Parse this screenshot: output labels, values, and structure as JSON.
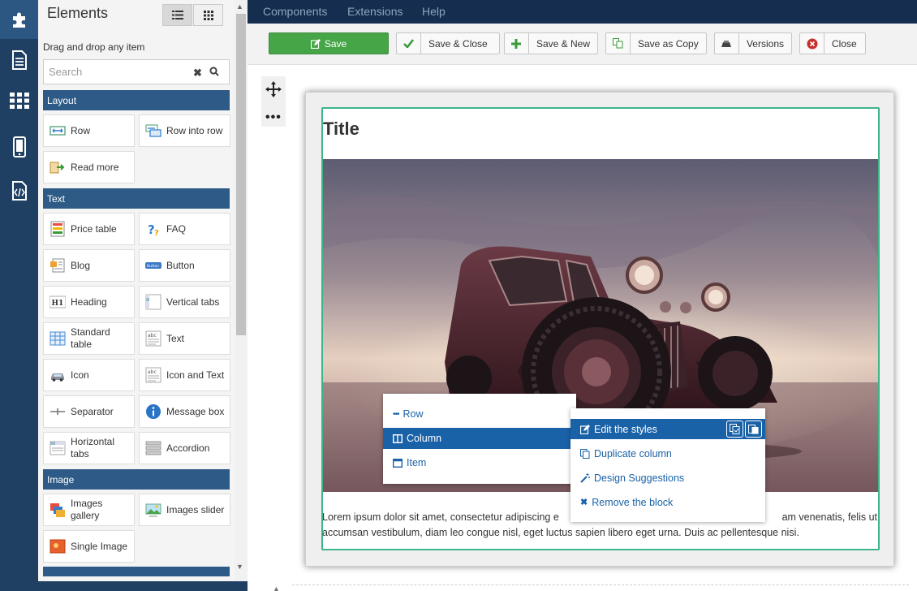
{
  "app": {
    "nav": [
      "Components",
      "Extensions",
      "Help"
    ]
  },
  "rail": {
    "icons": [
      "puzzle-icon",
      "document-icon",
      "grid-icon",
      "mobile-icon",
      "code-file-icon"
    ]
  },
  "panel": {
    "title": "Elements",
    "hint": "Drag and drop any item",
    "search_placeholder": "Search",
    "categories": {
      "layout": "Layout",
      "text": "Text",
      "image": "Image"
    },
    "layout_items": [
      "Row",
      "Row into row",
      "Read more"
    ],
    "text_items": [
      "Price table",
      "FAQ",
      "Blog",
      "Button",
      "Heading",
      "Vertical tabs",
      "Standard table",
      "Text",
      "Icon",
      "Icon and Text",
      "Separator",
      "Message box",
      "Horizontal tabs",
      "Accordion"
    ],
    "image_items": [
      "Images gallery",
      "Images slider",
      "Single Image"
    ]
  },
  "toolbar": {
    "save": "Save",
    "save_close": "Save & Close",
    "save_new": "Save & New",
    "save_copy": "Save as Copy",
    "versions": "Versions",
    "close": "Close"
  },
  "content": {
    "title": "Title",
    "paragraph_left": "Lorem ipsum dolor sit amet, consectetur adipiscing e",
    "paragraph_right": "am venenatis, felis ut",
    "paragraph_line2": "accumsan vestibulum, diam leo congue nisl, eget luctus sapien libero eget urna. Duis ac pellentesque nisi."
  },
  "context_menu": {
    "items": [
      "Row",
      "Column",
      "Item"
    ],
    "selected": "Column"
  },
  "column_menu": {
    "items": [
      "Edit the styles",
      "Duplicate column",
      "Design Suggestions",
      "Remove the block"
    ],
    "selected": "Edit the styles"
  },
  "colors": {
    "rail": "#1f3f63",
    "category": "#2d5a86",
    "accent": "#1a62a8",
    "save_green": "#46a546",
    "block_border": "#3eb489"
  }
}
